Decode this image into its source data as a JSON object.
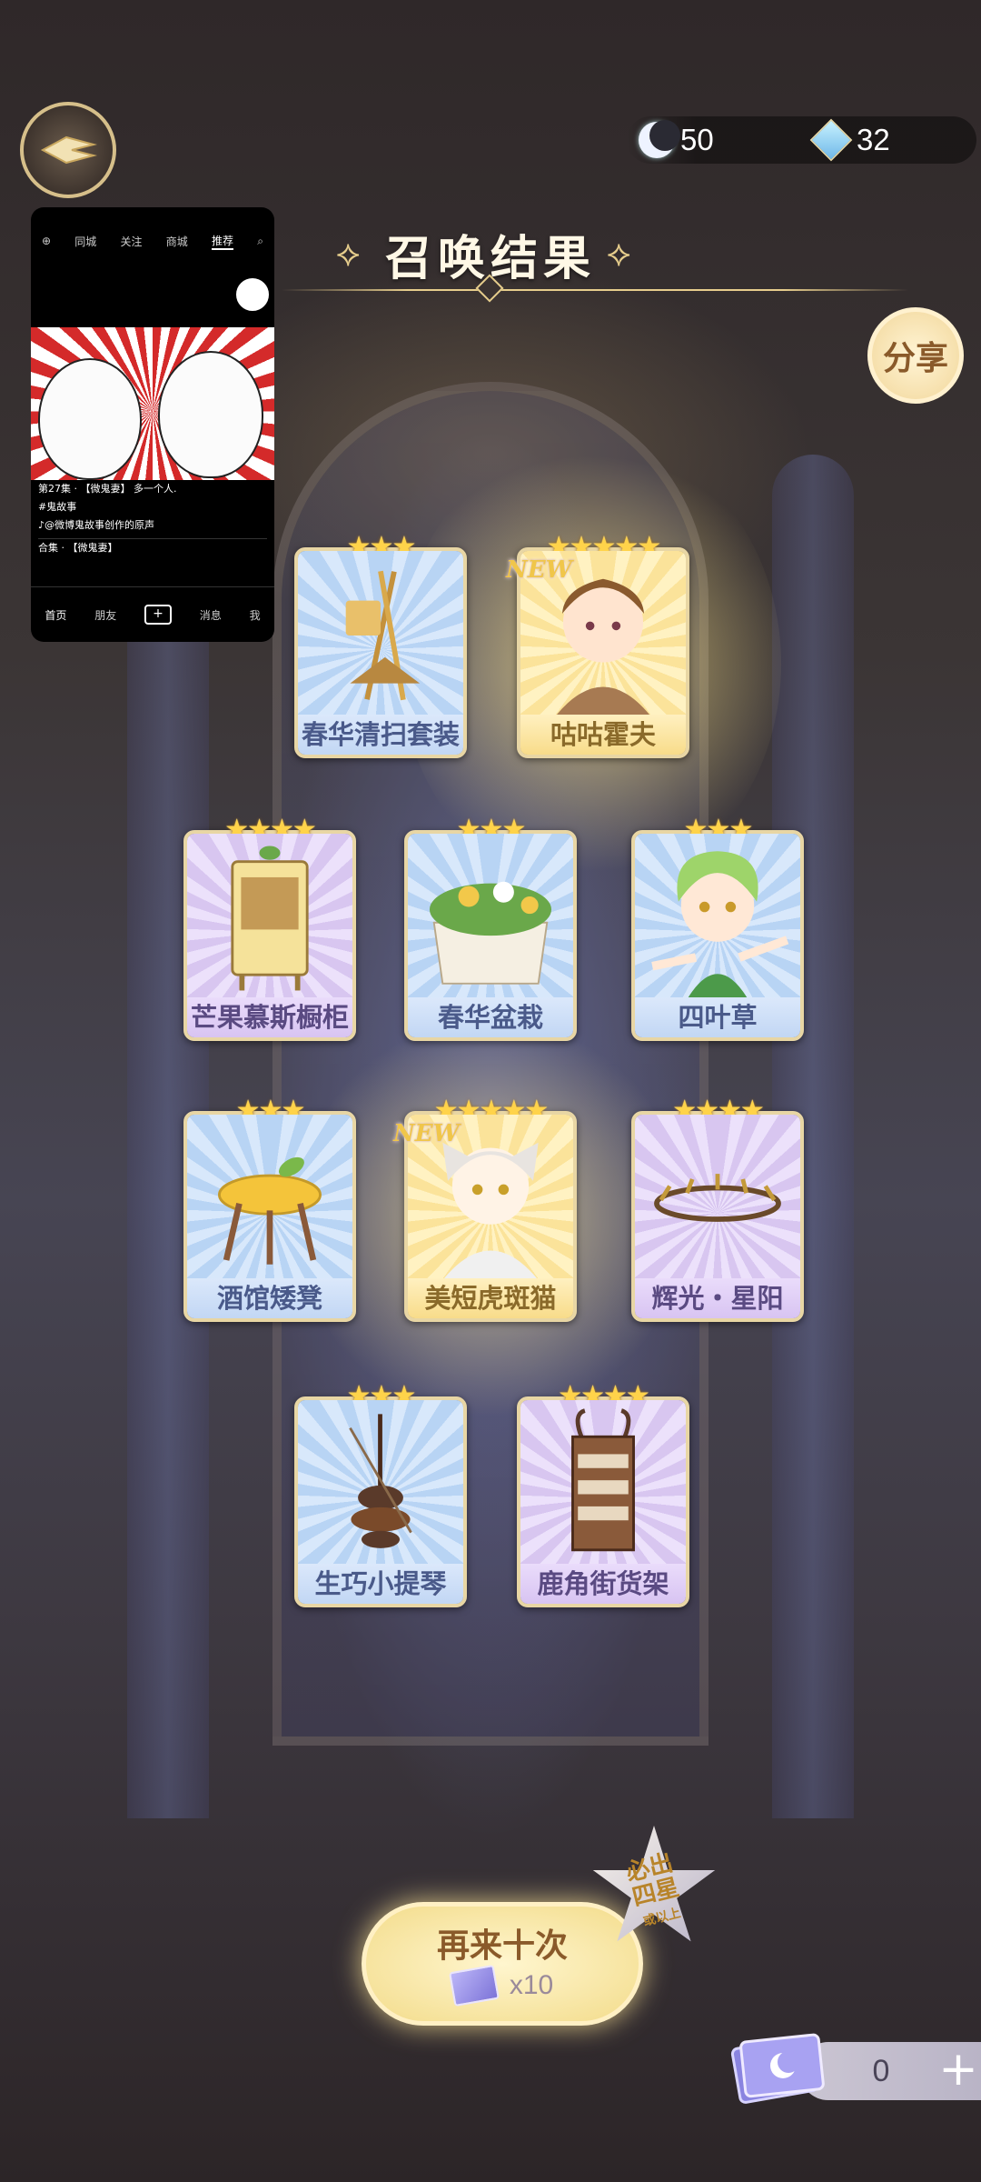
{
  "currency": {
    "moon_value": "50",
    "gem_value": "32",
    "moon_icon": "moon-icon",
    "gem_icon": "crystal-icon"
  },
  "title": "召唤结果",
  "share_label": "分享",
  "video": {
    "tabs": [
      "同城",
      "关注",
      "商城",
      "推荐"
    ],
    "caption_line1": "第27集 · 【微鬼妻】 多一个人.",
    "caption_line2": "#鬼故事",
    "caption_line3": "♪@微博鬼故事创作的原声",
    "collection": "合集 · 【微鬼妻】",
    "nav": [
      "首页",
      "朋友",
      "+",
      "消息",
      "我"
    ]
  },
  "cards": [
    {
      "name": "春华清扫套装",
      "stars": "★★★",
      "new": ""
    },
    {
      "name": "咕咕霍夫",
      "stars": "★★★★★",
      "new": "NEW"
    },
    {
      "name": "芒果慕斯橱柜",
      "stars": "★★★★",
      "new": ""
    },
    {
      "name": "春华盆栽",
      "stars": "★★★",
      "new": ""
    },
    {
      "name": "四叶草",
      "stars": "★★★",
      "new": ""
    },
    {
      "name": "酒馆矮凳",
      "stars": "★★★",
      "new": ""
    },
    {
      "name": "美短虎斑猫",
      "stars": "★★★★★",
      "new": "NEW"
    },
    {
      "name": "辉光・星阳",
      "stars": "★★★★",
      "new": ""
    },
    {
      "name": "生巧小提琴",
      "stars": "★★★",
      "new": ""
    },
    {
      "name": "鹿角街货架",
      "stars": "★★★★",
      "new": ""
    }
  ],
  "again_button": {
    "label": "再来十次",
    "cost": "x10"
  },
  "badge": {
    "line1": "必出",
    "line2": "四星",
    "line3": "或以上"
  },
  "tickets": {
    "count": "0",
    "add_label": "+"
  }
}
